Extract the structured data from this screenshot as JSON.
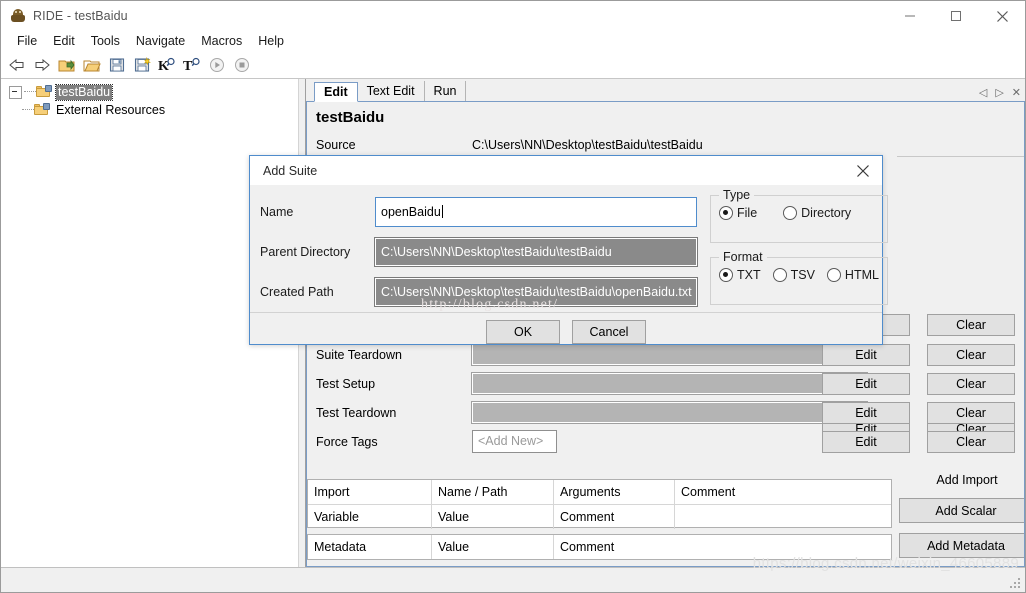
{
  "window": {
    "title": "RIDE - testBaidu",
    "icon": "robot-icon",
    "controls": {
      "minimize": "–",
      "maximize": "□",
      "close": "✕"
    }
  },
  "menubar": {
    "items": [
      {
        "label": "File"
      },
      {
        "label": "Edit"
      },
      {
        "label": "Tools"
      },
      {
        "label": "Navigate"
      },
      {
        "label": "Macros"
      },
      {
        "label": "Help"
      }
    ]
  },
  "toolbar": {
    "buttons": [
      {
        "name": "back-arrow-icon"
      },
      {
        "name": "forward-arrow-icon"
      },
      {
        "name": "open-directory-icon"
      },
      {
        "name": "open-folder-icon"
      },
      {
        "name": "save-icon"
      },
      {
        "name": "save-all-icon"
      },
      {
        "name": "search-keyword-icon"
      },
      {
        "name": "search-tests-icon"
      },
      {
        "name": "run-icon"
      },
      {
        "name": "stop-icon"
      }
    ]
  },
  "tree": {
    "items": [
      {
        "label": "testBaidu",
        "selected": true,
        "expanded": true
      },
      {
        "label": "External Resources",
        "selected": false,
        "expanded": false
      }
    ]
  },
  "tabs": {
    "items": [
      {
        "label": "Edit",
        "active": true
      },
      {
        "label": "Text Edit",
        "active": false
      },
      {
        "label": "Run",
        "active": false
      }
    ],
    "nav": {
      "prev": "◁",
      "next": "▷",
      "close": "✕"
    }
  },
  "editor": {
    "suite_title": "testBaidu",
    "source_label": "Source",
    "source_value": "C:\\Users\\NN\\Desktop\\testBaidu\\testBaidu",
    "settings_rows": [
      {
        "label": "Suite Teardown",
        "value": "",
        "field": "gray",
        "edit": "Edit",
        "clear": "Clear"
      },
      {
        "label": "Test Setup",
        "value": "",
        "field": "gray",
        "edit": "Edit",
        "clear": "Clear"
      },
      {
        "label": "Test Teardown",
        "value": "",
        "field": "gray",
        "edit": "Edit",
        "clear": "Clear"
      },
      {
        "label": "Force Tags",
        "value": "<Add New>",
        "field": "white",
        "edit": "Edit",
        "clear": "Clear"
      }
    ],
    "hidden_rows": [
      {
        "edit": "Edit",
        "clear": "Clear"
      },
      {
        "edit": "Edit",
        "clear": "Clear"
      }
    ],
    "import_table": {
      "header": [
        "Import",
        "Name / Path",
        "Arguments",
        "Comment"
      ],
      "rows": [
        [
          "Variable",
          "Value",
          "Comment",
          ""
        ]
      ]
    },
    "metadata_table": {
      "header": [
        "Metadata",
        "Value",
        "Comment"
      ]
    },
    "side_buttons": [
      {
        "label": "Add Import",
        "style": "flat"
      },
      {
        "label": "Add Scalar",
        "style": "button"
      },
      {
        "label": "Add Metadata",
        "style": "button"
      }
    ]
  },
  "dialog": {
    "title": "Add Suite",
    "close": "✕",
    "name_label": "Name",
    "name_value": "openBaidu",
    "parent_label": "Parent Directory",
    "parent_value": "C:\\Users\\NN\\Desktop\\testBaidu\\testBaidu",
    "created_label": "Created Path",
    "created_value": "C:\\Users\\NN\\Desktop\\testBaidu\\testBaidu\\openBaidu.txt",
    "type_group": {
      "title": "Type",
      "options": [
        {
          "label": "File",
          "checked": true
        },
        {
          "label": "Directory",
          "checked": false
        }
      ]
    },
    "format_group": {
      "title": "Format",
      "options": [
        {
          "label": "TXT",
          "checked": true
        },
        {
          "label": "TSV",
          "checked": false
        },
        {
          "label": "HTML",
          "checked": false
        }
      ]
    },
    "ok_label": "OK",
    "cancel_label": "Cancel"
  },
  "watermarks": {
    "dialog": "http://blog.csdn.net/",
    "bottom": "https://blog.csdn.net/weixin_46605889"
  },
  "colors": {
    "accent": "#4f8ccc",
    "window_bg": "#f0f0f0",
    "selection": "#808080",
    "disabled_field": "#8a8a8a"
  }
}
